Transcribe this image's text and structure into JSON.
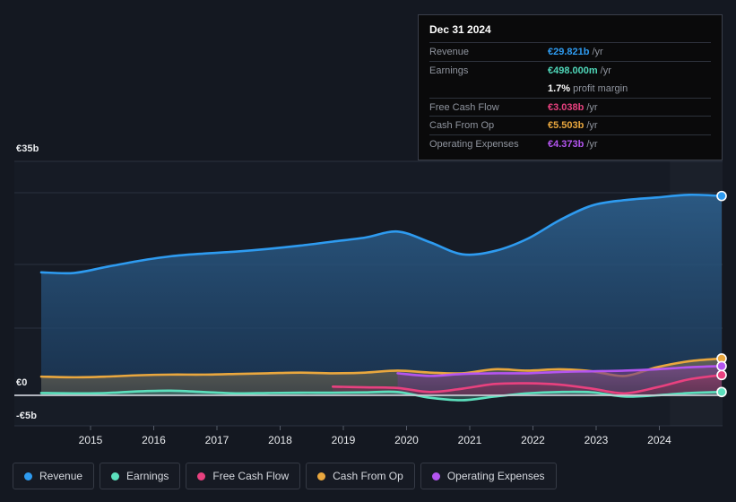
{
  "tooltip": {
    "title": "Dec 31 2024",
    "rows": [
      {
        "key": "Revenue",
        "value": "€29.821b",
        "unit": "/yr",
        "color": "#2e9bf0"
      },
      {
        "key": "Earnings",
        "value": "€498.000m",
        "unit": "/yr",
        "color": "#4fd6b8"
      },
      {
        "key": "",
        "value": "1.7%",
        "unit": "profit margin",
        "color": "#ffffff"
      },
      {
        "key": "Free Cash Flow",
        "value": "€3.038b",
        "unit": "/yr",
        "color": "#e8417f"
      },
      {
        "key": "Cash From Op",
        "value": "€5.503b",
        "unit": "/yr",
        "color": "#e9a73e"
      },
      {
        "key": "Operating Expenses",
        "value": "€4.373b",
        "unit": "/yr",
        "color": "#b455f0"
      }
    ]
  },
  "legend": {
    "items": [
      {
        "label": "Revenue",
        "color": "#2e9bf0"
      },
      {
        "label": "Earnings",
        "color": "#5ce0bd"
      },
      {
        "label": "Free Cash Flow",
        "color": "#e8417f"
      },
      {
        "label": "Cash From Op",
        "color": "#e9a73e"
      },
      {
        "label": "Operating Expenses",
        "color": "#b455f0"
      }
    ]
  },
  "chart_data": {
    "type": "area",
    "title": "",
    "xlabel": "",
    "ylabel": "",
    "currency": "EUR",
    "grid": true,
    "legend_position": "bottom",
    "ylim": [
      -5,
      35
    ],
    "y_ticks": [
      {
        "label": "€35b",
        "value": 35
      },
      {
        "label": "€0",
        "value": 0
      },
      {
        "label": "-€5b",
        "value": -5
      }
    ],
    "x_ticks": [
      "2015",
      "2016",
      "2017",
      "2018",
      "2019",
      "2020",
      "2021",
      "2022",
      "2023",
      "2024"
    ],
    "x": [
      2014.5,
      2015,
      2015.5,
      2016,
      2016.5,
      2017,
      2017.5,
      2018,
      2018.5,
      2019,
      2019.5,
      2020,
      2020.5,
      2021,
      2021.5,
      2022,
      2022.5,
      2023,
      2023.5,
      2024,
      2024.5,
      2025
    ],
    "series": [
      {
        "name": "Revenue",
        "color": "#2e9bf0",
        "fill": "#1d4b74",
        "values": [
          18.4,
          18.3,
          19.2,
          20.1,
          20.8,
          21.2,
          21.5,
          21.9,
          22.4,
          23.0,
          23.6,
          24.5,
          22.9,
          21.1,
          21.6,
          23.4,
          26.2,
          28.4,
          29.2,
          29.6,
          30.0,
          29.821
        ]
      },
      {
        "name": "Cash From Op",
        "color": "#e9a73e",
        "fill": "#6e6552",
        "values": [
          2.8,
          2.7,
          2.8,
          3.0,
          3.1,
          3.1,
          3.2,
          3.3,
          3.4,
          3.3,
          3.4,
          3.7,
          3.4,
          3.3,
          3.9,
          3.7,
          3.9,
          3.6,
          2.9,
          4.2,
          5.1,
          5.503
        ]
      },
      {
        "name": "Operating Expenses",
        "color": "#b455f0",
        "fill": "#6b3d80",
        "start_index": 11,
        "values": [
          null,
          null,
          null,
          null,
          null,
          null,
          null,
          null,
          null,
          null,
          null,
          3.3,
          2.9,
          3.2,
          3.3,
          3.3,
          3.5,
          3.6,
          3.7,
          3.9,
          4.2,
          4.373
        ]
      },
      {
        "name": "Free Cash Flow",
        "color": "#e8417f",
        "fill": "#7a3358",
        "start_index": 9,
        "values": [
          null,
          null,
          null,
          null,
          null,
          null,
          null,
          null,
          null,
          1.3,
          1.2,
          1.1,
          0.5,
          1.0,
          1.7,
          1.8,
          1.6,
          1.0,
          0.3,
          1.2,
          2.4,
          3.038
        ]
      },
      {
        "name": "Earnings",
        "color": "#5ce0bd",
        "fill": "#3c6d68",
        "values": [
          0.35,
          0.3,
          0.35,
          0.6,
          0.7,
          0.5,
          0.3,
          0.35,
          0.4,
          0.4,
          0.45,
          0.5,
          -0.4,
          -0.8,
          -0.2,
          0.3,
          0.5,
          0.45,
          -0.2,
          0.0,
          0.35,
          0.498
        ]
      }
    ],
    "forecast_band_start": "2024.2",
    "annotations": []
  }
}
